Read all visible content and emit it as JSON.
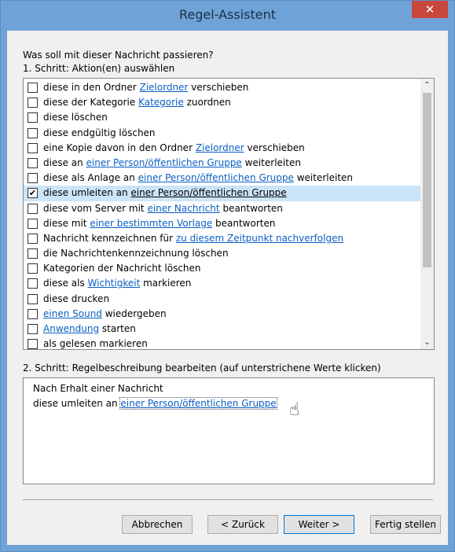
{
  "window": {
    "title": "Regel-Assistent",
    "close_label": "✕"
  },
  "question": "Was soll mit dieser Nachricht passieren?",
  "step1_label": "1. Schritt: Aktion(en) auswählen",
  "actions": [
    {
      "pre": "diese in den Ordner ",
      "link": "Zielordner",
      "post": " verschieben",
      "checked": false
    },
    {
      "pre": "diese der Kategorie ",
      "link": "Kategorie",
      "post": " zuordnen",
      "checked": false
    },
    {
      "pre": "diese löschen",
      "link": "",
      "post": "",
      "checked": false
    },
    {
      "pre": "diese endgültig löschen",
      "link": "",
      "post": "",
      "checked": false
    },
    {
      "pre": "eine Kopie davon in den Ordner ",
      "link": "Zielordner",
      "post": " verschieben",
      "checked": false
    },
    {
      "pre": "diese an ",
      "link": "einer Person/öffentlichen Gruppe",
      "post": " weiterleiten",
      "checked": false
    },
    {
      "pre": "diese als Anlage an ",
      "link": "einer Person/öffentlichen Gruppe",
      "post": " weiterleiten",
      "checked": false
    },
    {
      "pre": "diese umleiten an ",
      "link": "einer Person/öffentlichen Gruppe",
      "post": "",
      "checked": true
    },
    {
      "pre": "diese vom Server mit ",
      "link": "einer Nachricht",
      "post": " beantworten",
      "checked": false
    },
    {
      "pre": "diese mit ",
      "link": "einer bestimmten Vorlage",
      "post": " beantworten",
      "checked": false
    },
    {
      "pre": "Nachricht kennzeichnen für ",
      "link": "zu diesem Zeitpunkt nachverfolgen",
      "post": "",
      "checked": false
    },
    {
      "pre": "die Nachrichtenkennzeichnung löschen",
      "link": "",
      "post": "",
      "checked": false
    },
    {
      "pre": "Kategorien der Nachricht löschen",
      "link": "",
      "post": "",
      "checked": false
    },
    {
      "pre": "diese als ",
      "link": "Wichtigkeit",
      "post": " markieren",
      "checked": false
    },
    {
      "pre": "diese drucken",
      "link": "",
      "post": "",
      "checked": false
    },
    {
      "pre": "",
      "link": "einen Sound",
      "post": " wiedergeben",
      "checked": false
    },
    {
      "pre": "",
      "link": "Anwendung",
      "post": " starten",
      "checked": false
    },
    {
      "pre": "als gelesen markieren",
      "link": "",
      "post": "",
      "checked": false
    }
  ],
  "scroll": {
    "up_glyph": "⌃",
    "down_glyph": "⌄"
  },
  "step2_label": "2. Schritt: Regelbeschreibung bearbeiten (auf unterstrichene Werte klicken)",
  "description": {
    "line1": "Nach Erhalt einer Nachricht",
    "line2_pre": "diese umleiten an ",
    "line2_link": "einer Person/öffentlichen Gruppe"
  },
  "buttons": {
    "cancel": "Abbrechen",
    "back": "< Zurück",
    "next": "Weiter >",
    "finish": "Fertig stellen"
  },
  "colors": {
    "link": "#0b5fc4",
    "selected_row": "#cce4f7",
    "title_bar": "#6fa3d8",
    "close": "#c7473d"
  }
}
